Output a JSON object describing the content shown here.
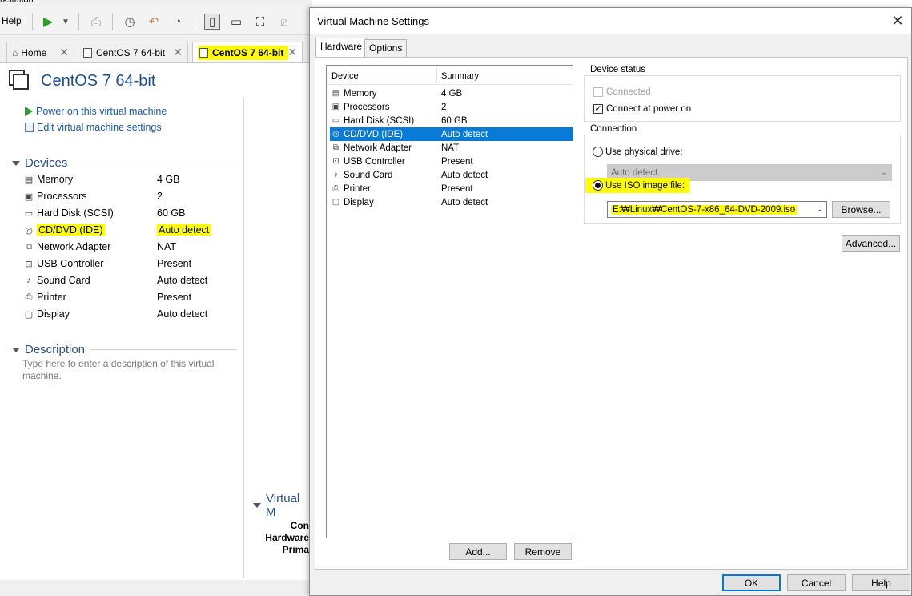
{
  "app": {
    "title_partial": "rkstation",
    "menu_help": "Help",
    "tabs": [
      {
        "label": "Home"
      },
      {
        "label": "CentOS 7 64-bit"
      },
      {
        "label": "CentOS 7 64-bit"
      }
    ]
  },
  "vm": {
    "title": "CentOS 7 64-bit",
    "actions": {
      "power_on": "Power on this virtual machine",
      "edit_settings": "Edit virtual machine settings"
    },
    "devices_heading": "Devices",
    "devices": [
      {
        "name": "Memory",
        "summary": "4 GB",
        "icon": "memory-icon"
      },
      {
        "name": "Processors",
        "summary": "2",
        "icon": "processor-icon"
      },
      {
        "name": "Hard Disk (SCSI)",
        "summary": "60 GB",
        "icon": "hard-disk-icon"
      },
      {
        "name": "CD/DVD (IDE)",
        "summary": "Auto detect",
        "icon": "cd-dvd-icon"
      },
      {
        "name": "Network Adapter",
        "summary": "NAT",
        "icon": "network-icon"
      },
      {
        "name": "USB Controller",
        "summary": "Present",
        "icon": "usb-icon"
      },
      {
        "name": "Sound Card",
        "summary": "Auto detect",
        "icon": "sound-icon"
      },
      {
        "name": "Printer",
        "summary": "Present",
        "icon": "printer-icon"
      },
      {
        "name": "Display",
        "summary": "Auto detect",
        "icon": "display-icon"
      }
    ],
    "description_heading": "Description",
    "description_placeholder": "Type here to enter a description of this virtual machine.",
    "details_heading": "Virtual M",
    "details_labels": [
      "Con",
      "Hardware",
      "Prima"
    ]
  },
  "dialog": {
    "title": "Virtual Machine Settings",
    "tabs": {
      "hardware": "Hardware",
      "options": "Options"
    },
    "list_headers": {
      "device": "Device",
      "summary": "Summary"
    },
    "devices": [
      {
        "name": "Memory",
        "summary": "4 GB",
        "icon": "memory-icon"
      },
      {
        "name": "Processors",
        "summary": "2",
        "icon": "processor-icon"
      },
      {
        "name": "Hard Disk (SCSI)",
        "summary": "60 GB",
        "icon": "hard-disk-icon"
      },
      {
        "name": "CD/DVD (IDE)",
        "summary": "Auto detect",
        "icon": "cd-dvd-icon",
        "selected": true
      },
      {
        "name": "Network Adapter",
        "summary": "NAT",
        "icon": "network-icon"
      },
      {
        "name": "USB Controller",
        "summary": "Present",
        "icon": "usb-icon"
      },
      {
        "name": "Sound Card",
        "summary": "Auto detect",
        "icon": "sound-icon"
      },
      {
        "name": "Printer",
        "summary": "Present",
        "icon": "printer-icon"
      },
      {
        "name": "Display",
        "summary": "Auto detect",
        "icon": "display-icon"
      }
    ],
    "add_button": "Add...",
    "remove_button": "Remove",
    "device_status": {
      "heading": "Device status",
      "connected": {
        "label": "Connected",
        "checked": false,
        "enabled": false
      },
      "connect_at_power_on": {
        "label": "Connect at power on",
        "checked": true
      }
    },
    "connection": {
      "heading": "Connection",
      "physical_drive": {
        "label": "Use physical drive:",
        "selected": false
      },
      "physical_drive_value": "Auto detect",
      "iso_image": {
        "label": "Use ISO image file:",
        "selected": true
      },
      "iso_path": "E:₩Linux₩CentOS-7-x86_64-DVD-2009.iso",
      "browse_button": "Browse..."
    },
    "advanced_button": "Advanced...",
    "ok_button": "OK",
    "cancel_button": "Cancel",
    "help_button": "Help"
  },
  "colors": {
    "highlight": "#ffff00",
    "selection": "#0a7ad7",
    "link": "#1b5aa6",
    "heading": "#2b4f8a"
  }
}
